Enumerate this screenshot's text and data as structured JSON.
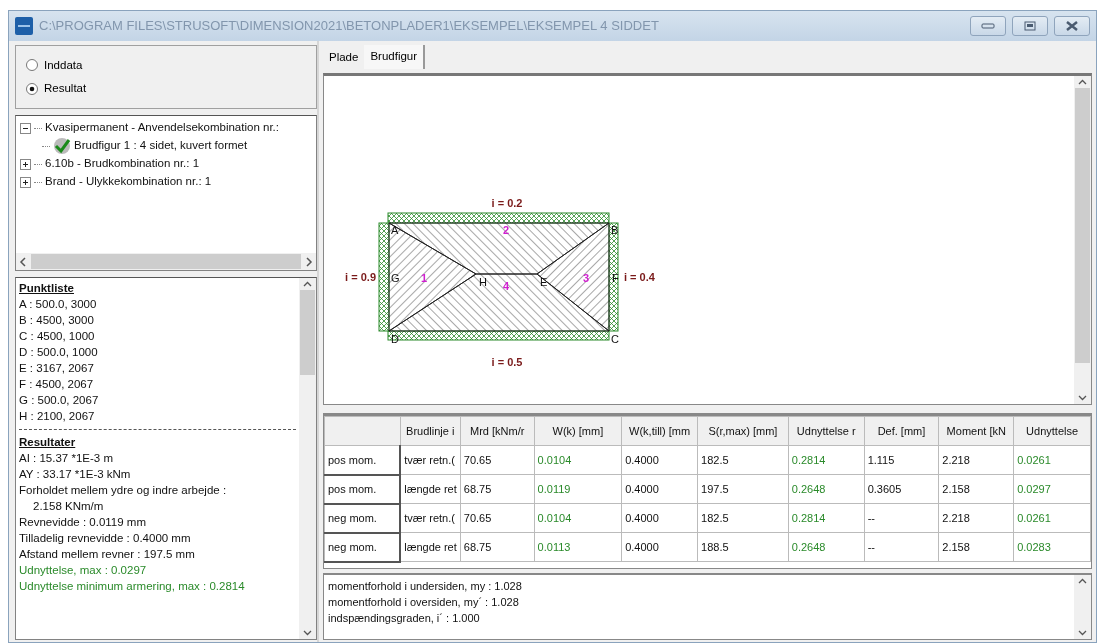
{
  "window": {
    "title": "C:\\PROGRAM FILES\\STRUSOFT\\DIMENSION2021\\BETONPLADER1\\EKSEMPEL\\EKSEMPEL 4 SIDDET"
  },
  "mode": [
    {
      "label": "Inddata",
      "selected": false
    },
    {
      "label": "Resultat",
      "selected": true
    }
  ],
  "tree": [
    {
      "label": "Kvasipermanent - Anvendelsekombination nr.:",
      "expanded": true,
      "children": [
        {
          "label": "Brudfigur 1 : 4 sidet, kuvert formet",
          "checked": true
        }
      ]
    },
    {
      "label": "6.10b - Brudkombination nr.: 1",
      "expanded": false
    },
    {
      "label": "Brand - Ulykkekombination nr.: 1",
      "expanded": false
    }
  ],
  "report": [
    {
      "kind": "heading",
      "text": "Punktliste"
    },
    {
      "kind": "line",
      "text": "A : 500.0, 3000"
    },
    {
      "kind": "line",
      "text": "B : 4500, 3000"
    },
    {
      "kind": "line",
      "text": "C : 4500, 1000"
    },
    {
      "kind": "line",
      "text": "D : 500.0, 1000"
    },
    {
      "kind": "line",
      "text": "E : 3167, 2067"
    },
    {
      "kind": "line",
      "text": "F : 4500, 2067"
    },
    {
      "kind": "line",
      "text": "G : 500.0, 2067"
    },
    {
      "kind": "line",
      "text": "H : 2100, 2067"
    },
    {
      "kind": "separator"
    },
    {
      "kind": "heading",
      "text": "Resultater"
    },
    {
      "kind": "line",
      "text": "AI : 15.37 *1E-3 m"
    },
    {
      "kind": "line",
      "text": "AY : 33.17 *1E-3 kNm"
    },
    {
      "kind": "line",
      "text": "Forholdet mellem ydre og indre arbejde :"
    },
    {
      "kind": "indent",
      "text": "2.158 KNm/m"
    },
    {
      "kind": "line",
      "text": "Revnevidde : 0.0119 mm"
    },
    {
      "kind": "line",
      "text": "Tilladelig revnevidde : 0.4000 mm"
    },
    {
      "kind": "line",
      "text": "Afstand mellem revner : 197.5 mm"
    },
    {
      "kind": "ok",
      "text": "Udnyttelse, max : 0.0297"
    },
    {
      "kind": "ok",
      "text": "Udnyttelse minimum armering, max : 0.2814"
    }
  ],
  "tabs": [
    {
      "label": "Plade",
      "selected": false
    },
    {
      "label": "Brudfigur",
      "selected": true
    }
  ],
  "figure": {
    "edges": [
      "i = 0.2",
      "i = 0.9",
      "i = 0.4",
      "i = 0.5"
    ],
    "points": [
      "A",
      "B",
      "G",
      "H",
      "E",
      "F",
      "D",
      "C"
    ],
    "regions": [
      "2",
      "1",
      "3",
      "4"
    ]
  },
  "table": {
    "columns": [
      {
        "label": "Brudlinje i",
        "passed": false
      },
      {
        "label": "Mrd [kNm/r",
        "passed": false
      },
      {
        "label": "W(k) [mm]",
        "passed": true
      },
      {
        "label": "W(k,till) [mm",
        "passed": false
      },
      {
        "label": "S(r,max) [mm]",
        "passed": false
      },
      {
        "label": "Udnyttelse r",
        "passed": true
      },
      {
        "label": "Def. [mm]",
        "passed": false
      },
      {
        "label": "Moment [kN",
        "passed": false
      },
      {
        "label": "Udnyttelse",
        "passed": true
      }
    ],
    "rows": [
      {
        "header": "pos mom.",
        "cells": [
          "tvær retn.(",
          "70.65",
          "0.0104",
          "0.4000",
          "182.5",
          "0.2814",
          "1.115",
          "2.218",
          "0.0261"
        ]
      },
      {
        "header": "pos mom.",
        "cells": [
          "længde ret",
          "68.75",
          "0.0119",
          "0.4000",
          "197.5",
          "0.2648",
          "0.3605",
          "2.158",
          "0.0297"
        ]
      },
      {
        "header": "neg mom.",
        "cells": [
          "tvær retn.(",
          "70.65",
          "0.0104",
          "0.4000",
          "182.5",
          "0.2814",
          "--",
          "2.218",
          "0.0261"
        ]
      },
      {
        "header": "neg mom.",
        "cells": [
          "længde ret",
          "68.75",
          "0.0113",
          "0.4000",
          "188.5",
          "0.2648",
          "--",
          "2.158",
          "0.0283"
        ]
      }
    ]
  },
  "messages": [
    "momentforhold i undersiden, my : 1.028",
    "momentforhold i oversiden, my´ : 1.028",
    "indspændingsgraden, i´ : 1.000"
  ]
}
